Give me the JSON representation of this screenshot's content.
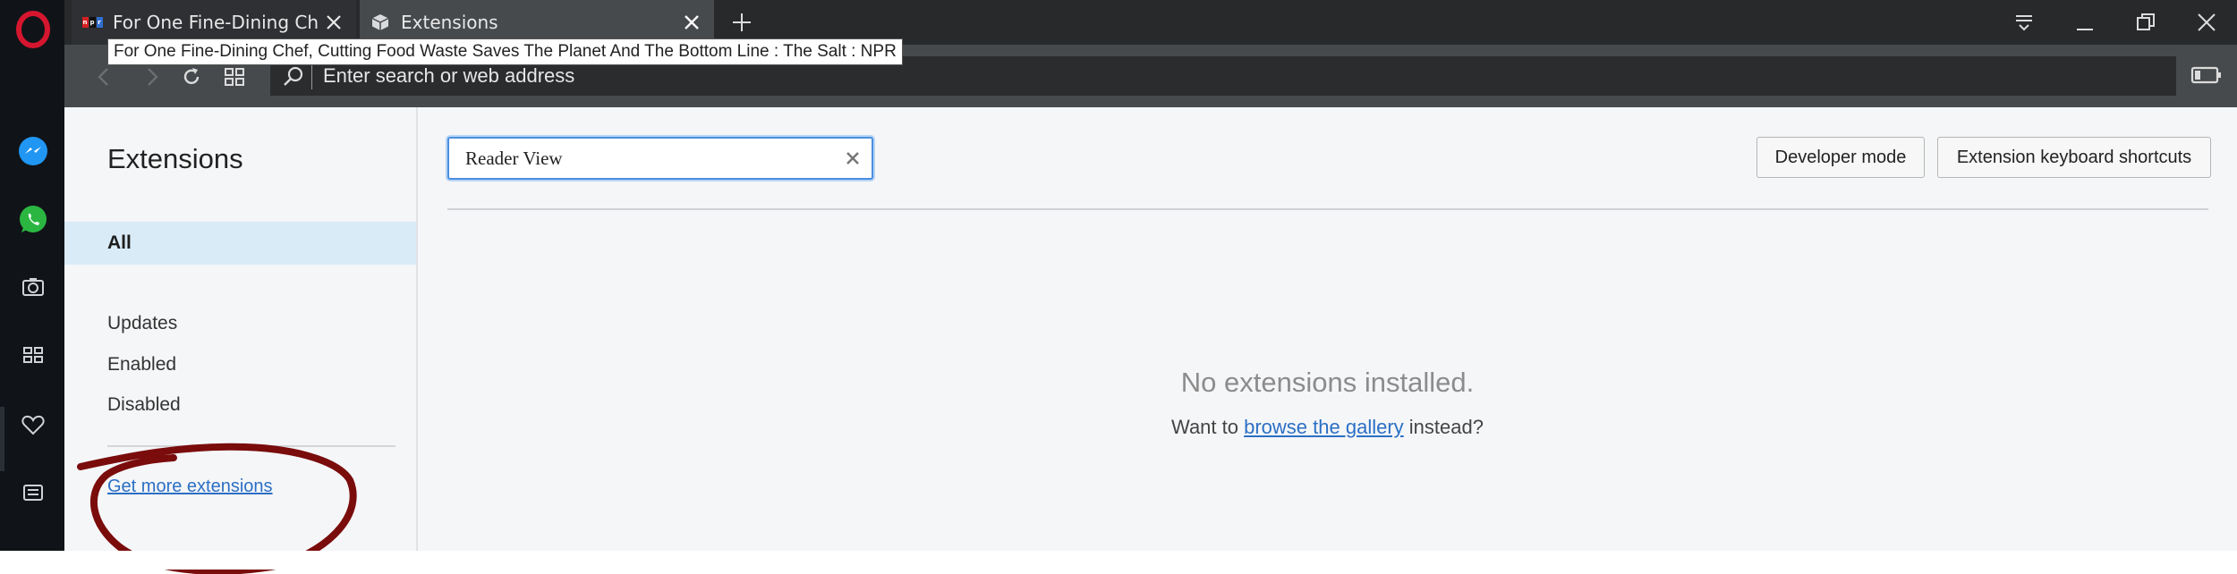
{
  "colors": {
    "sidebar_bg": "#101418",
    "opera_red": "#d6162f",
    "messenger_blue": "#2196f3",
    "whatsapp_green": "#2bb641",
    "link_blue": "#2b6fc4",
    "annotation_red": "#7a0c0c"
  },
  "sidebar": {
    "icons": [
      "opera-logo",
      "messenger-icon",
      "whatsapp-icon",
      "camera-icon",
      "speed-dial-icon",
      "heart-icon",
      "news-icon"
    ]
  },
  "tabs": [
    {
      "title": "For One Fine-Dining Chef, Cutting Food Waste Saves The Planet And The Bottom Line : The Salt : NPR",
      "favicon": "npr-favicon",
      "active": false
    },
    {
      "title": "Extensions",
      "favicon": "extensions-cube-icon",
      "active": true
    }
  ],
  "tooltip": "For One Fine-Dining Chef, Cutting Food Waste Saves The Planet And The Bottom Line : The Salt : NPR",
  "addressbar": {
    "placeholder": "Enter search or web address",
    "value": ""
  },
  "extensions": {
    "title": "Extensions",
    "nav": {
      "all": "All",
      "updates": "Updates",
      "enabled": "Enabled",
      "disabled": "Disabled",
      "more": "Get more extensions"
    },
    "search": {
      "value": "Reader View"
    },
    "buttons": {
      "developer_mode": "Developer mode",
      "keyboard_shortcuts": "Extension keyboard shortcuts"
    },
    "empty": {
      "title": "No extensions installed.",
      "prefix": "Want to",
      "link": "browse the gallery",
      "suffix": "instead?"
    }
  }
}
